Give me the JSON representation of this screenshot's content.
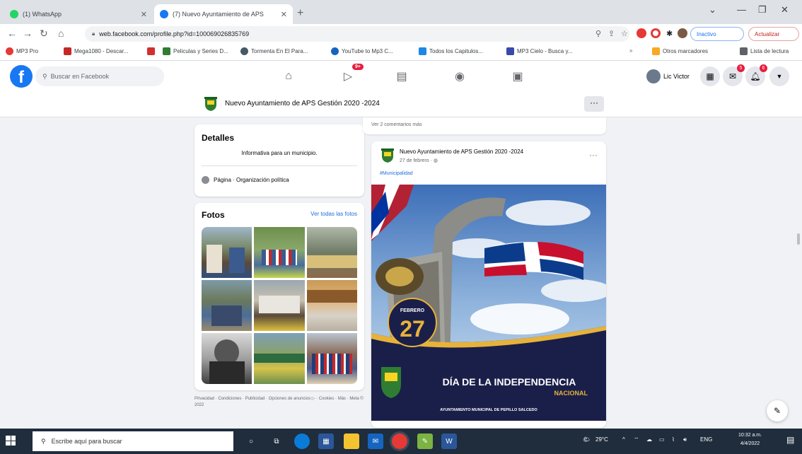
{
  "browser": {
    "tabs": [
      {
        "title": "(1) WhatsApp",
        "active": false,
        "icon": "whatsapp-icon",
        "color": "#25d366"
      },
      {
        "title": "(7) Nuevo Ayuntamiento de APS",
        "active": true,
        "icon": "facebook-icon",
        "color": "#1877f2"
      }
    ],
    "url": "web.facebook.com/profile.php?id=100069026835769",
    "pill_inactive": "Inactivo",
    "pill_update": "Actualizar",
    "bookmarks": [
      {
        "label": "MP3 Pro",
        "color": "#e53935"
      },
      {
        "label": "Mega1080 - Descar...",
        "color": "#c62828"
      },
      {
        "label": "",
        "color": "#d32f2f"
      },
      {
        "label": "Peliculas y Series D...",
        "color": "#2e7d32"
      },
      {
        "label": "Tormenta En El Para...",
        "color": "#455a64"
      },
      {
        "label": "YouTube to Mp3 C...",
        "color": "#1565c0"
      },
      {
        "label": "Todos los Capitulos...",
        "color": "#1e88e5"
      },
      {
        "label": "MP3 Cielo - Busca y...",
        "color": "#3949ab"
      },
      {
        "label": "Otros marcadores",
        "color": "#f9a825"
      },
      {
        "label": "Lista de lectura",
        "color": "#5f6368"
      }
    ]
  },
  "facebook": {
    "search_placeholder": "Buscar en Facebook",
    "watch_badge": "9+",
    "user_name": "Lic Victor",
    "messenger_badge": "5",
    "notif_badge": "6",
    "page_name": "Nuevo Ayuntamiento de APS Gestión 2020 -2024",
    "more_label": "···"
  },
  "details": {
    "title": "Detalles",
    "description": "Informativa para un municipio.",
    "category": "Página · Organización política"
  },
  "photos": {
    "title": "Fotos",
    "see_all": "Ver todas las fotos"
  },
  "footer": "Privacidad · Condiciones · Publicidad · Opciones de anuncios ▷ · Cookies · Más · Meta © 2022",
  "post": {
    "comments_link": "Ver 2 comentarios más",
    "author": "Nuevo Ayuntamiento de APS Gestión 2020 -2024",
    "date": "27 de febrero ·",
    "hashtag": "#Municipalidad",
    "image_month": "FEBRERO",
    "image_day": "27",
    "image_title": "DÍA DE LA INDEPENDENCIA",
    "image_subtitle": "NACIONAL",
    "image_footer": "AYUNTAMIENTO MUNICIPAL DE PEPILLO SALCEDO"
  },
  "taskbar": {
    "search_placeholder": "Escribe aquí para buscar",
    "temperature": "29°C",
    "language": "ENG",
    "time": "10:32 a.m.",
    "date": "4/4/2022"
  }
}
